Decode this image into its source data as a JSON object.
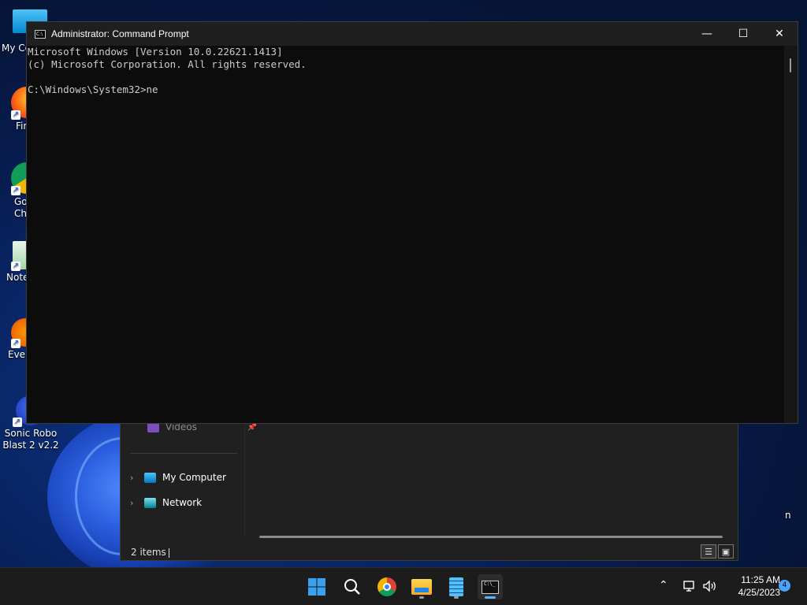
{
  "desktop": {
    "icons": [
      {
        "label": "My Co",
        "kind": "computer"
      },
      {
        "label": "Fir",
        "kind": "firefox"
      },
      {
        "label": "Go Chr",
        "kind": "chrome"
      },
      {
        "label": "Note",
        "kind": "notepad"
      },
      {
        "label": "Ever",
        "kind": "everything"
      },
      {
        "label": "Sonic Robo Blast 2 v2.2",
        "kind": "sonic"
      }
    ],
    "partial_right_label": "n"
  },
  "explorer": {
    "nav_items": [
      {
        "label": "Videos",
        "icon": "video-folder-icon"
      },
      {
        "label": "My Computer",
        "icon": "computer-icon"
      },
      {
        "label": "Network",
        "icon": "network-icon"
      }
    ],
    "status": "2 items"
  },
  "cmd": {
    "title": "Administrator: Command Prompt",
    "lines": [
      "Microsoft Windows [Version 10.0.22621.1413]",
      "(c) Microsoft Corporation. All rights reserved.",
      "",
      "C:\\Windows\\System32>ne"
    ],
    "controls": {
      "minimize": "—",
      "maximize": "☐",
      "close": "✕"
    }
  },
  "taskbar": {
    "apps": [
      "start-icon",
      "search-icon",
      "chrome-icon",
      "file-explorer-icon",
      "notepad-icon",
      "terminal-icon"
    ],
    "time": "11:25 AM",
    "date": "4/25/2023",
    "notification_count": "4"
  },
  "colors": {
    "accent": "#5cb3ff",
    "console_text": "#cccccc",
    "console_bg": "#0c0c0c"
  }
}
